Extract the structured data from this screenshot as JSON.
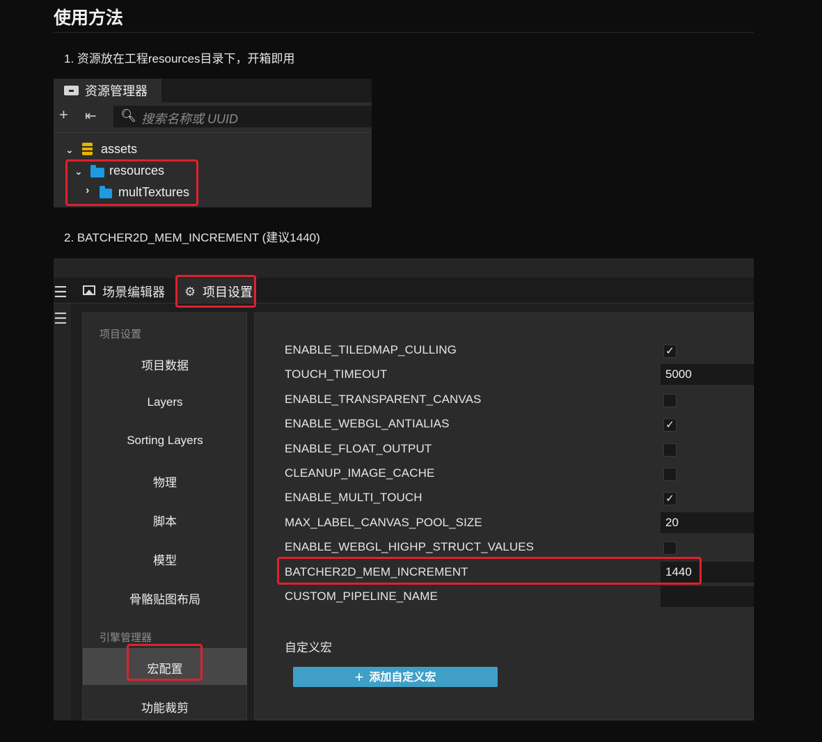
{
  "doc": {
    "title": "使用方法",
    "step1": "1. 资源放在工程resources目录下，开箱即用",
    "step2": "2. BATCHER2D_MEM_INCREMENT (建议1440)"
  },
  "asset_panel": {
    "tab_label": "资源管理器",
    "search_placeholder": "搜索名称或 UUID",
    "tree": {
      "root": "assets",
      "child": "resources",
      "grandchild": "multTextures"
    },
    "folder_color": "#1e9ae0",
    "db_icon_color": "#e6b400"
  },
  "editor": {
    "tabs": {
      "scene": "场景编辑器",
      "project": "项目设置"
    },
    "sidebar": {
      "section1": "项目设置",
      "items1": [
        "项目数据",
        "Layers",
        "Sorting Layers",
        "物理",
        "脚本",
        "模型",
        "骨骼贴图布局"
      ],
      "section2": "引擎管理器",
      "items2": [
        "宏配置",
        "功能裁剪"
      ],
      "active": "宏配置"
    },
    "props": [
      {
        "label": "ENABLE_TILEDMAP_CULLING",
        "type": "checkbox",
        "checked": true
      },
      {
        "label": "TOUCH_TIMEOUT",
        "type": "number",
        "value": "5000"
      },
      {
        "label": "ENABLE_TRANSPARENT_CANVAS",
        "type": "checkbox",
        "checked": false
      },
      {
        "label": "ENABLE_WEBGL_ANTIALIAS",
        "type": "checkbox",
        "checked": true
      },
      {
        "label": "ENABLE_FLOAT_OUTPUT",
        "type": "checkbox",
        "checked": false
      },
      {
        "label": "CLEANUP_IMAGE_CACHE",
        "type": "checkbox",
        "checked": false
      },
      {
        "label": "ENABLE_MULTI_TOUCH",
        "type": "checkbox",
        "checked": true
      },
      {
        "label": "MAX_LABEL_CANVAS_POOL_SIZE",
        "type": "number",
        "value": "20"
      },
      {
        "label": "ENABLE_WEBGL_HIGHP_STRUCT_VALUES",
        "type": "checkbox",
        "checked": false
      },
      {
        "label": "BATCHER2D_MEM_INCREMENT",
        "type": "number",
        "value": "1440"
      },
      {
        "label": "CUSTOM_PIPELINE_NAME",
        "type": "text",
        "value": ""
      }
    ],
    "custom_macro_title": "自定义宏",
    "add_macro_button": "添加自定义宏",
    "accent_color": "#3f9fc6",
    "highlight_color": "#e0212f"
  }
}
